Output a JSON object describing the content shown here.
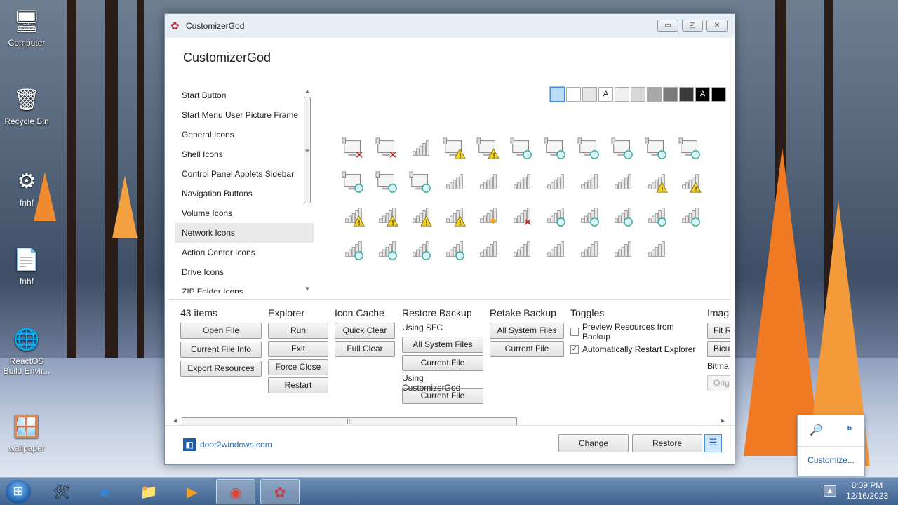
{
  "desktop": {
    "icons": [
      {
        "label": "Computer",
        "glyph": "🖥"
      },
      {
        "label": "Recycle Bin",
        "glyph": "🗑"
      },
      {
        "label": "fnhf",
        "glyph": "⚙"
      },
      {
        "label": "fnhf",
        "glyph": "📄"
      },
      {
        "label": "ReactOS Build Envir...",
        "glyph": "🌐"
      },
      {
        "label": "wallpaper",
        "glyph": "🪟"
      }
    ]
  },
  "window": {
    "title": "CustomizerGod",
    "header": "CustomizerGod",
    "controls": {
      "minimize": "▭",
      "maximize": "◰",
      "close": "✕"
    }
  },
  "categories": {
    "selected": "Network Icons",
    "items": [
      "Start Button",
      "Start Menu User Picture Frame",
      "General Icons",
      "Shell Icons",
      "Control Panel Applets Sidebar",
      "Navigation Buttons",
      "Volume Icons",
      "Network Icons",
      "Action Center Icons",
      "Drive Icons",
      "ZIP Folder Icons"
    ]
  },
  "swatches": [
    {
      "color": "#bcdcf7",
      "label": "",
      "selected": true
    },
    {
      "color": "#ffffff",
      "label": ""
    },
    {
      "color": "#e6e6e6",
      "label": ""
    },
    {
      "color": "#ffffff",
      "label": "A"
    },
    {
      "color": "#f0f0f0",
      "label": ""
    },
    {
      "color": "#d8d8d8",
      "label": ""
    },
    {
      "color": "#a8a8a8",
      "label": ""
    },
    {
      "color": "#7a7a7a",
      "label": ""
    },
    {
      "color": "#3a3a3a",
      "label": ""
    },
    {
      "color": "#000000",
      "label": "A"
    },
    {
      "color": "#000000",
      "label": ""
    }
  ],
  "network_icons": [
    "monitor-error",
    "monitor-error",
    "signal-bars",
    "monitor-warning",
    "monitor-warning",
    "monitor-connecting",
    "monitor-connecting",
    "monitor-connecting",
    "monitor-connecting",
    "monitor-connecting",
    "monitor-connecting",
    "monitor-connecting",
    "monitor-connecting",
    "monitor-connecting",
    "signal-bars",
    "signal-bars",
    "signal-bars",
    "signal-bars",
    "signal-bars",
    "signal-bars",
    "signal-warning",
    "signal-warning",
    "signal-warning",
    "signal-warning",
    "signal-warning",
    "signal-warning",
    "signal-star",
    "signal-error",
    "signal-connecting",
    "signal-connecting",
    "signal-connecting",
    "signal-connecting",
    "signal-connecting",
    "signal-connecting",
    "signal-connecting",
    "signal-connecting",
    "signal-connecting",
    "signal-bars",
    "signal-bars",
    "signal-bars",
    "signal-bars",
    "signal-bars",
    "signal-bars"
  ],
  "panel": {
    "items_count": "43 items",
    "file_buttons": [
      "Open File",
      "Current File Info",
      "Export Resources"
    ],
    "explorer": {
      "title": "Explorer",
      "buttons": [
        "Run",
        "Exit",
        "Force Close",
        "Restart"
      ]
    },
    "icon_cache": {
      "title": "Icon Cache",
      "buttons": [
        "Quick Clear",
        "Full Clear"
      ]
    },
    "restore_backup": {
      "title": "Restore Backup",
      "using_sfc": "Using SFC",
      "sfc_buttons": [
        "All System Files",
        "Current File"
      ],
      "using_customizergod": "Using CustomizerGod",
      "cg_buttons": [
        "Current File"
      ]
    },
    "retake_backup": {
      "title": "Retake Backup",
      "buttons": [
        "All System Files",
        "Current File"
      ]
    },
    "toggles": {
      "title": "Toggles",
      "items": [
        {
          "label": "Preview Resources from Backup",
          "checked": false,
          "mark": ""
        },
        {
          "label": "Automatically Restart Explorer",
          "checked": true,
          "mark": "✓"
        }
      ]
    },
    "image": {
      "title": "Imag",
      "buttons": [
        "Fit R",
        "Bicu"
      ],
      "bitmap_title": "Bitma",
      "bitmap_button": "Orig"
    }
  },
  "footer": {
    "site": "door2windows.com",
    "change": "Change",
    "restore": "Restore",
    "menu": "☰"
  },
  "tray_popup": {
    "customize": "Customize...",
    "icons": [
      "🔎",
      "ᵇ"
    ]
  },
  "taskbar": {
    "time": "8:39 PM",
    "date": "12/16/2023",
    "apps": [
      "🛠",
      "e",
      "📁",
      "▶",
      "◉",
      "✿"
    ]
  }
}
